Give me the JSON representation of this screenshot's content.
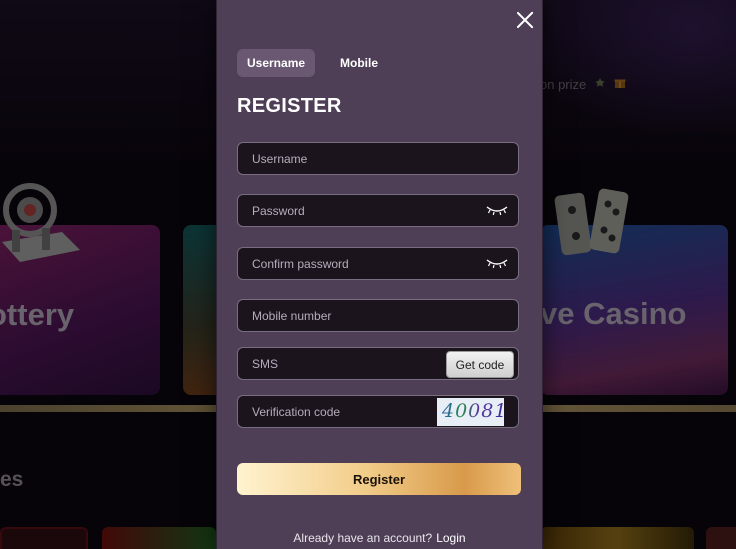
{
  "background": {
    "prize_text": "on prize",
    "cards": [
      {
        "title": "ottery"
      },
      {
        "title": "ve Casino"
      }
    ],
    "section_title": "es"
  },
  "modal": {
    "tabs": [
      {
        "label": "Username",
        "active": true
      },
      {
        "label": "Mobile",
        "active": false
      }
    ],
    "heading": "REGISTER",
    "fields": {
      "username": {
        "placeholder": "Username",
        "value": ""
      },
      "password": {
        "placeholder": "Password",
        "value": ""
      },
      "confirm_password": {
        "placeholder": "Confirm password",
        "value": ""
      },
      "mobile": {
        "placeholder": "Mobile number",
        "value": ""
      },
      "sms": {
        "placeholder": "SMS",
        "value": "",
        "button_label": "Get code"
      },
      "verification": {
        "placeholder": "Verification code",
        "value": "",
        "captcha_text": "40081"
      }
    },
    "register_label": "Register",
    "footer": {
      "prompt": "Already have an account?",
      "link": "Login"
    }
  },
  "colors": {
    "modal_bg": "#4e3f56",
    "field_bg": "#1b141d",
    "button_gold": "#f2cd8a",
    "overlay": "#0b070d"
  },
  "icons": [
    "close-icon",
    "eye-closed-icon",
    "gift-icon",
    "clover-icon"
  ]
}
